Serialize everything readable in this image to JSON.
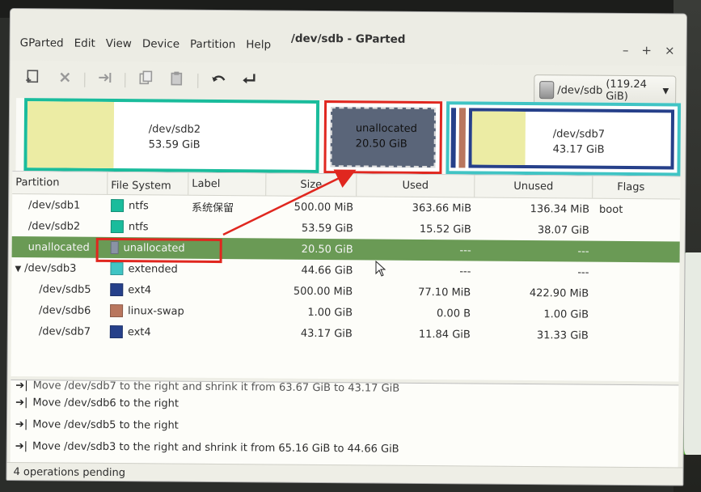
{
  "window": {
    "title": "/dev/sdb - GParted"
  },
  "menubar": [
    "GParted",
    "Edit",
    "View",
    "Device",
    "Partition",
    "Help"
  ],
  "toolbar": {
    "icons": [
      "new-partition-icon",
      "delete-icon",
      "resize-move-icon",
      "copy-icon",
      "paste-icon",
      "undo-icon",
      "apply-icon"
    ]
  },
  "device_selector": {
    "device": "/dev/sdb",
    "size": "(119.24 GiB)"
  },
  "disk_graphic": {
    "sdb2": {
      "name": "/dev/sdb2",
      "size": "53.59 GiB"
    },
    "unallocated": {
      "name": "unallocated",
      "size": "20.50 GiB"
    },
    "sdb7": {
      "name": "/dev/sdb7",
      "size": "43.17 GiB"
    }
  },
  "table": {
    "headers": [
      "Partition",
      "File System",
      "Label",
      "Size",
      "Used",
      "Unused",
      "Flags"
    ],
    "rows": [
      {
        "partition": "/dev/sdb1",
        "fs": "ntfs",
        "fs_color": "#1abc9c",
        "label": "系统保留",
        "size": "500.00 MiB",
        "used": "363.66 MiB",
        "unused": "136.34 MiB",
        "flags": "boot"
      },
      {
        "partition": "/dev/sdb2",
        "fs": "ntfs",
        "fs_color": "#1abc9c",
        "label": "",
        "size": "53.59 GiB",
        "used": "15.52 GiB",
        "unused": "38.07 GiB",
        "flags": ""
      },
      {
        "partition": "unallocated",
        "fs": "unallocated",
        "fs_color": "#8a93a6",
        "label": "",
        "size": "20.50 GiB",
        "used": "---",
        "unused": "---",
        "flags": ""
      },
      {
        "partition": "/dev/sdb3",
        "fs": "extended",
        "fs_color": "#40c4c4",
        "label": "",
        "size": "44.66 GiB",
        "used": "---",
        "unused": "---",
        "flags": ""
      },
      {
        "partition": "/dev/sdb5",
        "fs": "ext4",
        "fs_color": "#26408a",
        "label": "",
        "size": "500.00 MiB",
        "used": "77.10 MiB",
        "unused": "422.90 MiB",
        "flags": ""
      },
      {
        "partition": "/dev/sdb6",
        "fs": "linux-swap",
        "fs_color": "#b9765e",
        "label": "",
        "size": "1.00 GiB",
        "used": "0.00 B",
        "unused": "1.00 GiB",
        "flags": ""
      },
      {
        "partition": "/dev/sdb7",
        "fs": "ext4",
        "fs_color": "#26408a",
        "label": "",
        "size": "43.17 GiB",
        "used": "11.84 GiB",
        "unused": "31.33 GiB",
        "flags": ""
      }
    ]
  },
  "operations": [
    "Move /dev/sdb7 to the right and shrink it from 63.67 GiB to 43.17 GiB",
    "Move /dev/sdb6 to the right",
    "Move /dev/sdb5 to the right",
    "Move /dev/sdb3 to the right and shrink it from 65.16 GiB to 44.66 GiB"
  ],
  "status": "4 operations pending",
  "colors": {
    "selected_row": "#6a9a55",
    "annotation": "#e0271f",
    "ntfs": "#1abc9c",
    "ext4": "#26408a",
    "swap": "#b9765e",
    "extended": "#40c4c4"
  }
}
